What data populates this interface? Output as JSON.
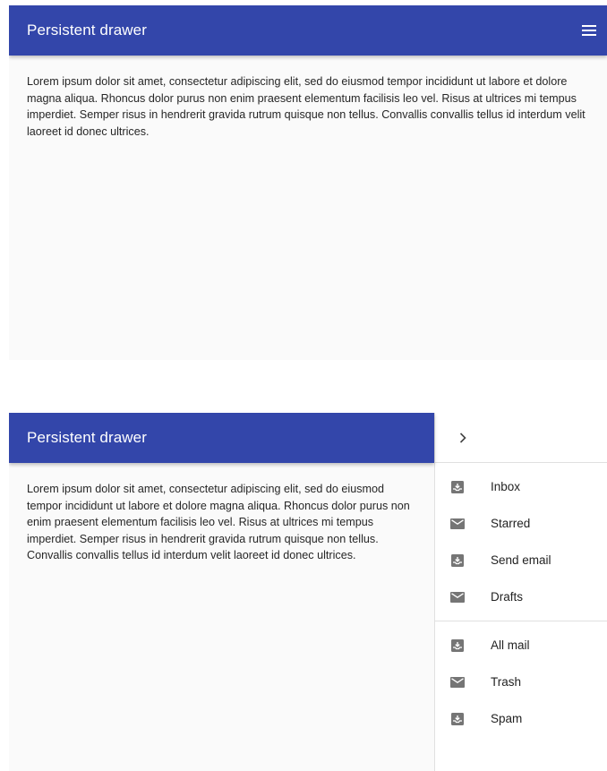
{
  "top_panel": {
    "appbar": {
      "title": "Persistent drawer",
      "menu_icon": "hamburger-menu-icon"
    },
    "content": {
      "paragraph": "Lorem ipsum dolor sit amet, consectetur adipiscing elit, sed do eiusmod tempor incididunt ut labore et dolore magna aliqua. Rhoncus dolor purus non enim praesent elementum facilisis leo vel. Risus at ultrices mi tempus imperdiet. Semper risus in hendrerit gravida rutrum quisque non tellus. Convallis convallis tellus id interdum velit laoreet id donec ultrices."
    }
  },
  "bottom_panel": {
    "appbar": {
      "title": "Persistent drawer"
    },
    "content": {
      "paragraph": "Lorem ipsum dolor sit amet, consectetur adipiscing elit, sed do eiusmod tempor incididunt ut labore et dolore magna aliqua. Rhoncus dolor purus non enim praesent elementum facilisis leo vel. Risus at ultrices mi tempus imperdiet. Semper risus in hendrerit gravida rutrum quisque non tellus. Convallis convallis tellus id interdum velit laoreet id donec ultrices."
    },
    "drawer": {
      "close_icon": "chevron-right-icon",
      "primary_items": [
        {
          "label": "Inbox",
          "icon": "move-to-inbox-icon"
        },
        {
          "label": "Starred",
          "icon": "mail-icon"
        },
        {
          "label": "Send email",
          "icon": "move-to-inbox-icon"
        },
        {
          "label": "Drafts",
          "icon": "mail-icon"
        }
      ],
      "secondary_items": [
        {
          "label": "All mail",
          "icon": "move-to-inbox-icon"
        },
        {
          "label": "Trash",
          "icon": "mail-icon"
        },
        {
          "label": "Spam",
          "icon": "move-to-inbox-icon"
        }
      ]
    }
  },
  "colors": {
    "appbar": "#3346aa",
    "appbar_text": "#ffffff",
    "content_background": "#fafafa",
    "icon": "#757575"
  }
}
